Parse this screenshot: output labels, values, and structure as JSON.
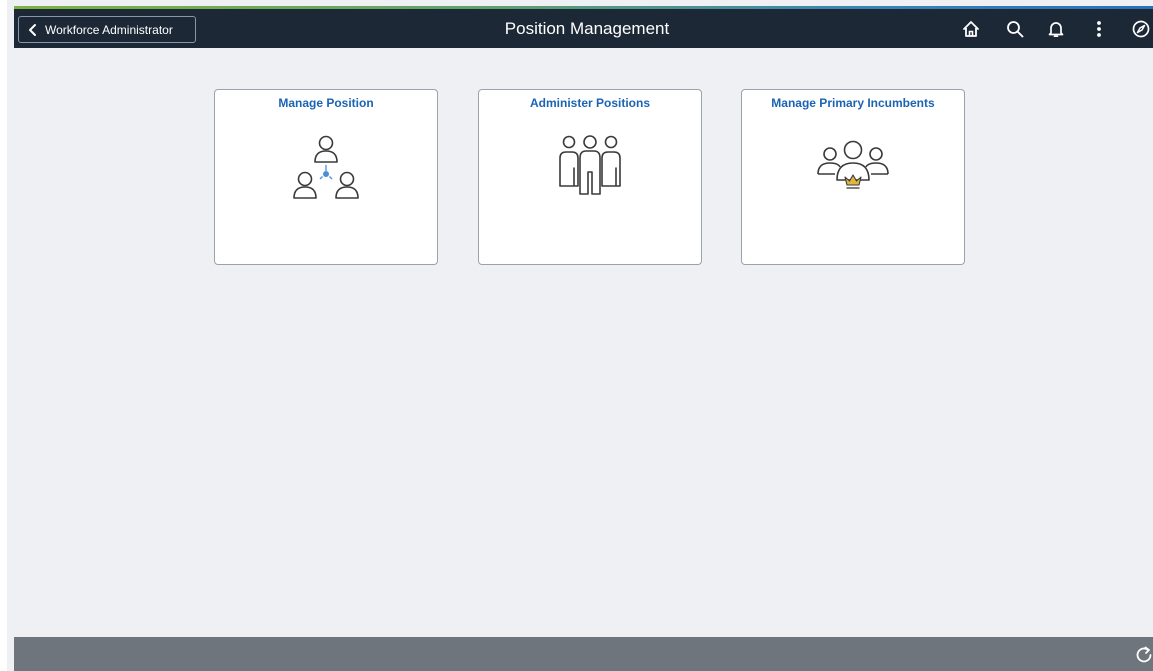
{
  "header": {
    "back_label": "Workforce Administrator",
    "title": "Position Management",
    "icons": [
      "home-icon",
      "search-icon",
      "notifications-icon",
      "actions-menu-icon",
      "navbar-icon"
    ]
  },
  "tiles": [
    {
      "label": "Manage Position",
      "icon": "position-hierarchy-icon"
    },
    {
      "label": "Administer Positions",
      "icon": "group-people-icon"
    },
    {
      "label": "Manage Primary Incumbents",
      "icon": "people-crown-icon"
    }
  ],
  "footer": {
    "icons": [
      "refresh-icon"
    ]
  },
  "colors": {
    "header_bg": "#1c2836",
    "content_bg": "#eff0f4",
    "tile_title": "#1b64b4",
    "footer_bg": "#6e757d",
    "crown": "#e3b53c",
    "accent_node": "#4a90d9"
  }
}
